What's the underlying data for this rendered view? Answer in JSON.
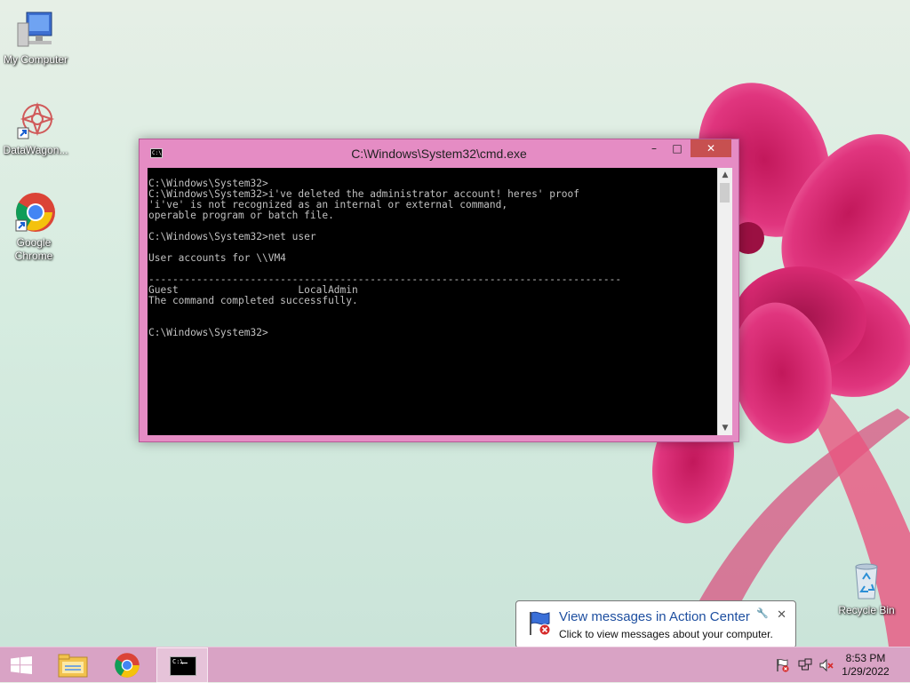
{
  "desktop": {
    "icons": [
      {
        "label": "My Computer"
      },
      {
        "label": "DataWagon..."
      },
      {
        "label": "Google Chrome"
      },
      {
        "label": "Recycle Bin"
      }
    ]
  },
  "window": {
    "title": "C:\\Windows\\System32\\cmd.exe",
    "app_icon_text": "C:\\",
    "minimize_glyph": "–",
    "maximize_glyph": "□",
    "close_glyph": "✕",
    "console_lines": [
      "C:\\Windows\\System32>",
      "C:\\Windows\\System32>i've deleted the administrator account! heres' proof",
      "'i've' is not recognized as an internal or external command,",
      "operable program or batch file.",
      "",
      "C:\\Windows\\System32>net user",
      "",
      "User accounts for \\\\VM4",
      "",
      "-------------------------------------------------------------------------------",
      "Guest                    LocalAdmin",
      "The command completed successfully.",
      "",
      "",
      "C:\\Windows\\System32>"
    ]
  },
  "notification": {
    "heading": "View messages in Action Center",
    "body": "Click to view messages about your computer.",
    "close_glyph": "✕"
  },
  "taskbar": {
    "start_icon": "windows-logo-icon",
    "pinned": [
      "file-explorer-icon",
      "chrome-icon",
      "cmd-icon"
    ],
    "cmd_icon_text": "C:\\",
    "tray": [
      "action-center-flag-icon",
      "network-icon",
      "volume-muted-icon"
    ],
    "clock": {
      "time": "8:53 PM",
      "date": "1/29/2022"
    }
  },
  "colors": {
    "taskbar": "#d9a3c5",
    "window_frame": "#e58cc4",
    "close_button": "#c75050",
    "console_bg": "#000000",
    "console_text": "#c0c0c0",
    "notification_heading": "#1e4fa0"
  }
}
